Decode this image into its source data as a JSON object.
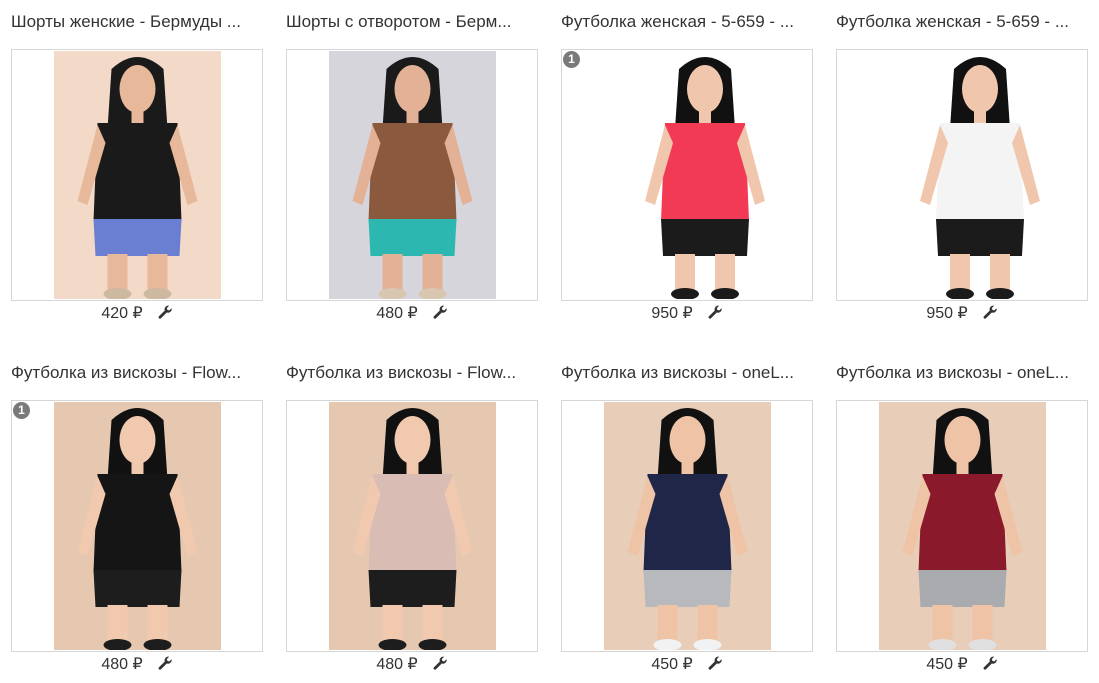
{
  "products": [
    {
      "title": "Шорты женские - Бермуды ...",
      "price": "420 ₽",
      "icon": "wrench-icon",
      "badge": null,
      "photo": {
        "bg": "#f3d9c8",
        "skin": "#e8b89a",
        "top": "#1a1a1a",
        "bottom": "#6a7fd1",
        "hair": "#1a1a1a",
        "shoes": "#cdb8a0"
      }
    },
    {
      "title": "Шорты с отворотом - Берм...",
      "price": "480 ₽",
      "icon": "wrench-icon",
      "badge": null,
      "photo": {
        "bg": "#d7d5dc",
        "skin": "#e2b196",
        "top": "#8b5a3e",
        "bottom": "#2cb8b0",
        "hair": "#1a1a1a",
        "shoes": "#d8c6b0"
      }
    },
    {
      "title": "Футболка женская - 5-659 - ...",
      "price": "950 ₽",
      "icon": "wrench-icon",
      "badge": "1",
      "photo": {
        "bg": "#ffffff",
        "skin": "#f0c7ad",
        "top": "#f23a55",
        "bottom": "#1b1b1b",
        "hair": "#111111",
        "shoes": "#1b1b1b"
      }
    },
    {
      "title": "Футболка женская - 5-659 - ...",
      "price": "950 ₽",
      "icon": "wrench-icon",
      "badge": null,
      "photo": {
        "bg": "#ffffff",
        "skin": "#f0c7ad",
        "top": "#f4f4f4",
        "bottom": "#1b1b1b",
        "hair": "#111111",
        "shoes": "#1b1b1b"
      }
    },
    {
      "title": "Футболка из вискозы - Flow...",
      "price": "480 ₽",
      "icon": "wrench-icon",
      "badge": "1",
      "photo": {
        "bg": "#e6c8b0",
        "skin": "#f1c9ae",
        "top": "#151515",
        "bottom": "#1d1d1d",
        "hair": "#111111",
        "shoes": "#1d1d1d"
      }
    },
    {
      "title": "Футболка из вискозы - Flow...",
      "price": "480 ₽",
      "icon": "wrench-icon",
      "badge": null,
      "photo": {
        "bg": "#e6c8b0",
        "skin": "#f1c9ae",
        "top": "#d9bcb4",
        "bottom": "#1d1d1d",
        "hair": "#111111",
        "shoes": "#1d1d1d"
      }
    },
    {
      "title": "Футболка из вискозы - oneL...",
      "price": "450 ₽",
      "icon": "wrench-icon",
      "badge": null,
      "photo": {
        "bg": "#e8cdb9",
        "skin": "#efc3a6",
        "top": "#1f2647",
        "bottom": "#b7b9bd",
        "hair": "#111111",
        "shoes": "#f2f2f2"
      }
    },
    {
      "title": "Футболка из вискозы - oneL...",
      "price": "450 ₽",
      "icon": "wrench-icon",
      "badge": null,
      "photo": {
        "bg": "#e8cdb9",
        "skin": "#efc3a6",
        "top": "#8a1a2b",
        "bottom": "#a9abaf",
        "hair": "#111111",
        "shoes": "#e0e0e0"
      }
    }
  ]
}
